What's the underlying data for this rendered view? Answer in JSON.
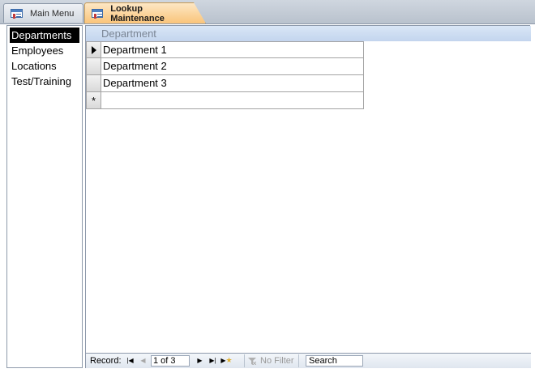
{
  "tabs": [
    {
      "label": "Main Menu",
      "icon": "form-icon",
      "active": false
    },
    {
      "label": "Lookup Maintenance",
      "icon": "form-icon",
      "active": true
    }
  ],
  "lookup_list": {
    "items": [
      "Departments",
      "Employees",
      "Locations",
      "Test/Training"
    ],
    "selected": "Departments"
  },
  "datasheet": {
    "column_header": "Department",
    "rows": [
      "Department 1",
      "Department 2",
      "Department 3"
    ],
    "new_record_symbol": "*"
  },
  "navigation": {
    "record_label": "Record:",
    "position": "1 of 3",
    "filter_label": "No Filter",
    "search_placeholder": "Search"
  },
  "colors": {
    "active_tab": "#f9c47a",
    "header_band": "#c3d5ee",
    "selected_item": "#000000"
  }
}
